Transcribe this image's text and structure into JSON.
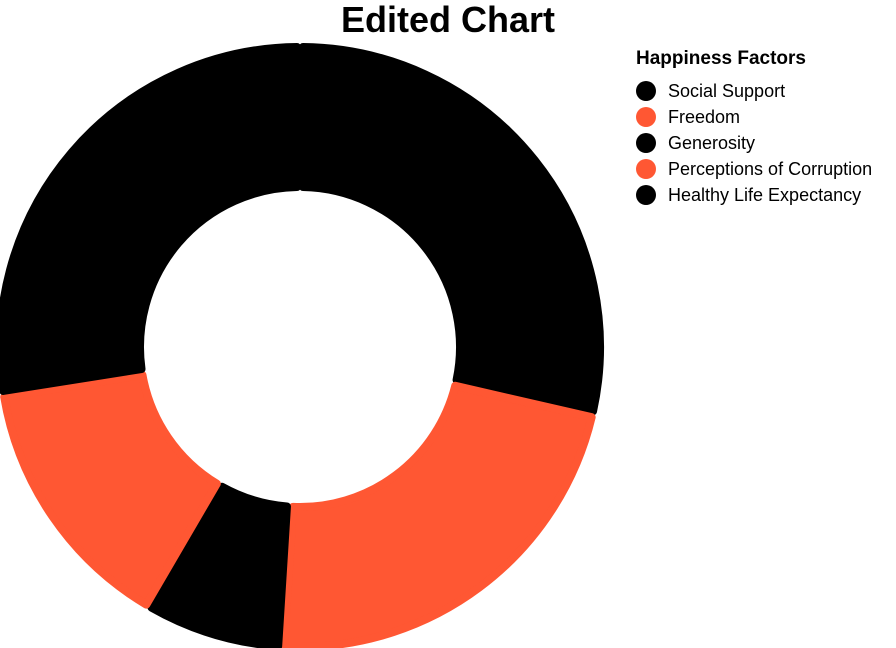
{
  "chart_data": {
    "type": "pie",
    "title": "Edited Chart",
    "donut": true,
    "legend": {
      "title": "Happiness Factors",
      "placement": "top-right"
    },
    "categories": [
      "Social Support",
      "Freedom",
      "Generosity",
      "Perceptions of Corruption",
      "Healthy Life Expectancy"
    ],
    "values": [
      28.6,
      22.4,
      7.4,
      14.1,
      27.5
    ],
    "colors": [
      "#000000",
      "#ff5733",
      "#000000",
      "#ff5733",
      "#000000"
    ]
  }
}
